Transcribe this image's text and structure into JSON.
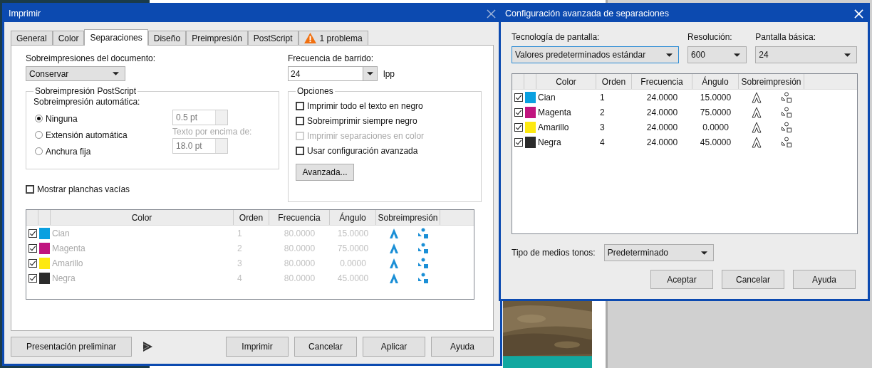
{
  "print_dialog": {
    "title": "Imprimir",
    "tabs": [
      {
        "label": "General",
        "selected": false,
        "kind": "plain"
      },
      {
        "label": "Color",
        "selected": false,
        "kind": "plain"
      },
      {
        "label": "Separaciones",
        "selected": true,
        "kind": "plain"
      },
      {
        "label": "Diseño",
        "selected": false,
        "kind": "plain"
      },
      {
        "label": "Preimpresión",
        "selected": false,
        "kind": "plain"
      },
      {
        "label": "PostScript",
        "selected": false,
        "kind": "plain"
      },
      {
        "label": "1 problema",
        "selected": false,
        "kind": "warning"
      }
    ],
    "document_overprint": {
      "label": "Sobreimpresiones del documento:",
      "value": "Conservar"
    },
    "screen_frequency": {
      "label": "Frecuencia de barrido:",
      "value": "24",
      "unit": "lpp"
    },
    "postscript_overprint": {
      "title": "Sobreimpresión PostScript",
      "auto_label": "Sobreimpresión automática:",
      "options": [
        {
          "label": "Ninguna",
          "selected": true
        },
        {
          "label": "Extensión automática",
          "selected": false
        },
        {
          "label": "Anchura fija",
          "selected": false
        }
      ],
      "width_value": "0.5 pt",
      "text_above_label": "Texto por encima de:",
      "text_size_value": "18.0 pt"
    },
    "options_group": {
      "title": "Opciones",
      "items": [
        {
          "label": "Imprimir todo el texto en negro",
          "checked": false,
          "disabled": false
        },
        {
          "label": "Sobreimprimir siempre negro",
          "checked": false,
          "disabled": false
        },
        {
          "label": "Imprimir separaciones en color",
          "checked": false,
          "disabled": true
        },
        {
          "label": "Usar configuración avanzada",
          "checked": false,
          "disabled": false
        }
      ],
      "advanced_button": "Avanzada..."
    },
    "show_empty_plates": {
      "label": "Mostrar planchas vacías",
      "checked": false
    },
    "table": {
      "disabled": true,
      "columns": [
        "Color",
        "Orden",
        "Frecuencia",
        "Ángulo",
        "Sobreimpresión"
      ],
      "rows": [
        {
          "checked": true,
          "color": "#0aa0e0",
          "name": "Cian",
          "order": "1",
          "frequency": "80.0000",
          "angle": "15.0000"
        },
        {
          "checked": true,
          "color": "#c0157f",
          "name": "Magenta",
          "order": "2",
          "frequency": "80.0000",
          "angle": "75.0000"
        },
        {
          "checked": true,
          "color": "#fde910",
          "name": "Amarillo",
          "order": "3",
          "frequency": "80.0000",
          "angle": "0.0000"
        },
        {
          "checked": true,
          "color": "#2b2b2b",
          "name": "Negra",
          "order": "4",
          "frequency": "80.0000",
          "angle": "45.0000"
        }
      ]
    },
    "preview_button": "Presentación preliminar",
    "buttons": [
      "Imprimir",
      "Cancelar",
      "Aplicar",
      "Ayuda"
    ]
  },
  "advanced_dialog": {
    "title": "Configuración avanzada de separaciones",
    "screen_technology": {
      "label": "Tecnología de pantalla:",
      "value": "Valores predeterminados estándar"
    },
    "resolution": {
      "label": "Resolución:",
      "value": "600"
    },
    "basic_screen": {
      "label": "Pantalla básica:",
      "value": "24"
    },
    "table": {
      "disabled": false,
      "columns": [
        "Color",
        "Orden",
        "Frecuencia",
        "Ángulo",
        "Sobreimpresión"
      ],
      "rows": [
        {
          "checked": true,
          "color": "#0aa0e0",
          "name": "Cian",
          "order": "1",
          "frequency": "24.0000",
          "angle": "15.0000"
        },
        {
          "checked": true,
          "color": "#c0157f",
          "name": "Magenta",
          "order": "2",
          "frequency": "24.0000",
          "angle": "75.0000"
        },
        {
          "checked": true,
          "color": "#fde910",
          "name": "Amarillo",
          "order": "3",
          "frequency": "24.0000",
          "angle": "0.0000"
        },
        {
          "checked": true,
          "color": "#2b2b2b",
          "name": "Negra",
          "order": "4",
          "frequency": "24.0000",
          "angle": "45.0000"
        }
      ]
    },
    "halftone": {
      "label": "Tipo de medios tonos:",
      "value": "Predeterminado"
    },
    "buttons": [
      "Aceptar",
      "Cancelar",
      "Ayuda"
    ]
  }
}
